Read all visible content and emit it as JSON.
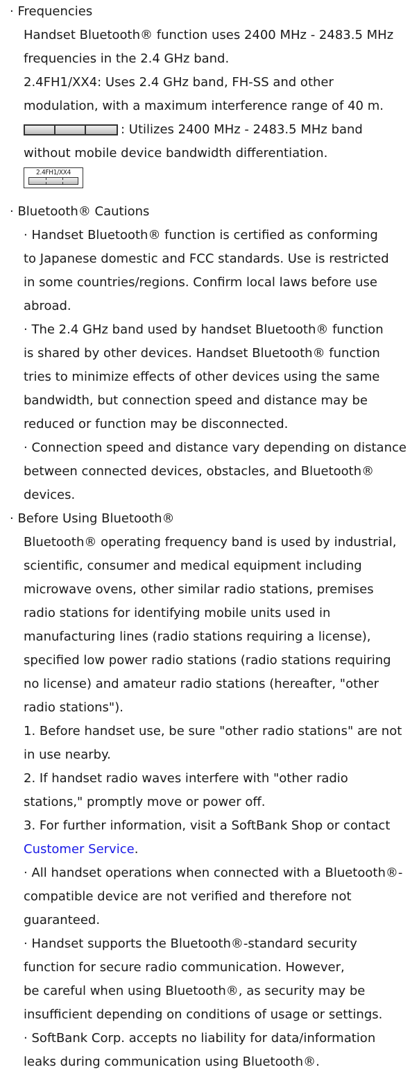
{
  "frequencies": {
    "heading": "· Frequencies",
    "lines": [
      "Handset Bluetooth® function uses 2400 MHz - 2483.5 MHz",
      "frequencies in the 2.4 GHz band.",
      "2.4FH1/XX4: Uses 2.4 GHz band, FH-SS and other",
      "modulation, with a maximum interference range of 40 m."
    ],
    "band_text": ": Utilizes 2400 MHz - 2483.5 MHz band",
    "band_text_2": "without mobile device bandwidth differentiation.",
    "label_icon_text": "2.4FH1/XX4"
  },
  "cautions": {
    "heading": "· Bluetooth® Cautions",
    "item1": [
      "· Handset Bluetooth® function is certified as conforming",
      "to Japanese domestic and FCC standards. Use is restricted",
      "in some countries/regions. Confirm local laws before use",
      "abroad."
    ],
    "item2": [
      "· The 2.4 GHz band used by handset Bluetooth® function",
      "is shared by other devices. Handset Bluetooth® function",
      "tries to minimize effects of other devices using the same",
      "bandwidth, but connection speed and distance may be",
      "reduced or function may be disconnected."
    ],
    "item3": [
      "· Connection speed and distance vary depending on distance",
      "between connected devices, obstacles, and Bluetooth®",
      "devices."
    ]
  },
  "before_using": {
    "heading": "· Before Using Bluetooth®",
    "body": [
      "Bluetooth® operating frequency band is used by industrial,",
      "scientific, consumer and medical equipment including",
      "microwave ovens, other similar radio stations, premises",
      "radio stations for identifying mobile units used in",
      "manufacturing lines (radio stations requiring a license),",
      "specified low power radio stations (radio stations requiring",
      "no license) and amateur radio stations (hereafter, \"other",
      "radio stations\")."
    ],
    "step1": [
      "1. Before handset use, be sure \"other radio stations\" are not",
      "in use nearby."
    ],
    "step2": [
      "2. If handset radio waves interfere with \"other radio",
      "stations,\" promptly move or power off."
    ],
    "step3": [
      "3. For further information, visit a SoftBank Shop or contact"
    ],
    "customer_service_link": "Customer Service",
    "customer_service_suffix": ".",
    "note1": [
      "· All handset operations when connected with a Bluetooth®-",
      "compatible device are not verified and therefore not",
      "guaranteed."
    ],
    "note2": [
      "· Handset supports the Bluetooth®-standard security",
      "function for secure radio communication. However,",
      "be careful when using Bluetooth®, as security may be",
      "insufficient depending on conditions of usage or settings."
    ],
    "note3": [
      "· SoftBank Corp. accepts no liability for data/information",
      "leaks during communication using Bluetooth®."
    ]
  },
  "colors": {
    "text": "#1a1a1a",
    "link": "#1a1ae6",
    "background": "#ffffff"
  }
}
